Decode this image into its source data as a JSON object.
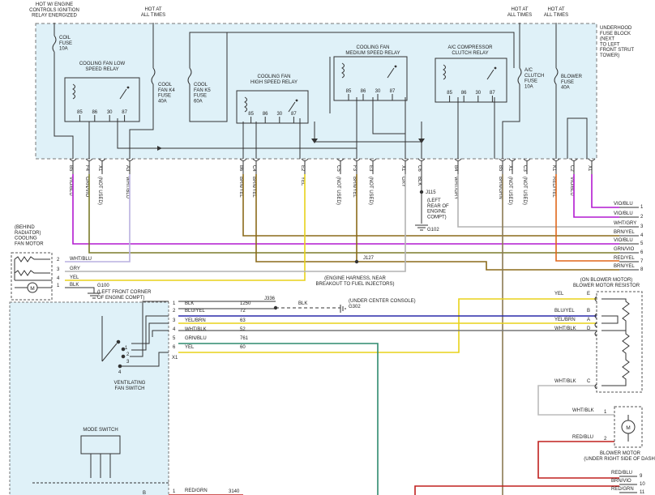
{
  "colors": {
    "fuse_block_fill": "#dff1f8",
    "wire_vio_blu": "#b21ad0",
    "wire_grn_vio": "#7b7b2a",
    "wire_wht_blu": "#b9b0e0",
    "wire_gry": "#b3b3b3",
    "wire_yel": "#e8d21a",
    "wire_brn_yel": "#8b6a1a",
    "wire_red_yel": "#e0671a",
    "wire_blu_yel": "#2a2aa8",
    "wire_grn_blu": "#2f8a6e",
    "wire_red_grn": "#c0201e",
    "wire_red_blu": "#c0201e"
  },
  "top_notes": {
    "hot_ign": "HOT W/ ENGINE\nCONTROLS IGNITION\nRELAY ENERGIZED",
    "hot_all_1": "HOT AT\nALL TIMES",
    "hot_all_2": "HOT AT\nALL TIMES",
    "hot_all_3": "HOT AT\nALL TIMES",
    "fuse_block": "UNDERHOOD\nFUSE BLOCK\n(NEXT\nTO LEFT\nFRONT STRUT\nTOWER)"
  },
  "fuses": {
    "coil": "COIL\nFUSE\n10A",
    "k4": "COOL\nFAN K4\nFUSE\n40A",
    "k5": "COOL\nFAN K5\nFUSE\n60A",
    "ac_clutch": "A/C\nCLUTCH\nFUSE\n10A",
    "blower": "BLOWER\nFUSE\n40A"
  },
  "relays": {
    "low": "COOLING FAN LOW\nSPEED RELAY",
    "high": "COOLING FAN\nHIGH SPEED RELAY",
    "medium": "COOLING FAN\nMEDIUM SPEED RELAY",
    "ac": "A/C COMPRESSOR\nCLUTCH RELAY",
    "pins": [
      "85",
      "86",
      "30",
      "87"
    ]
  },
  "connector_pins": [
    {
      "pin": "B5",
      "wire": "VIO/BLU"
    },
    {
      "pin": "F4",
      "wire": "GRN/VIO"
    },
    {
      "pin": "X1",
      "wire": "(NOT USED)"
    },
    {
      "pin": "A3",
      "wire": "WHT/BLU"
    },
    {
      "pin": "B6",
      "wire": "BRN/YEL"
    },
    {
      "pin": "C4",
      "wire": "BRN/YEL"
    },
    {
      "pin": "E2",
      "wire": "YEL"
    },
    {
      "pin": "C5",
      "wire": "(NOT USED)"
    },
    {
      "pin": "F3",
      "wire": "BRN/YEL"
    },
    {
      "pin": "E3",
      "wire": "(NOT USED)"
    },
    {
      "pin": "X1",
      "wire": "GRY"
    },
    {
      "pin": "C6",
      "wire": "BLK"
    },
    {
      "pin": "B4",
      "wire": "WHT/GRY"
    },
    {
      "pin": "B5",
      "wire": "BRN/GRN"
    },
    {
      "pin": "X1",
      "wire": "(NOT USED)"
    },
    {
      "pin": "C3",
      "wire": "(NOT USED)"
    },
    {
      "pin": "K1",
      "wire": "RED/YEL"
    },
    {
      "pin": "C2",
      "wire": "VIO/BLU"
    },
    {
      "pin": "X1",
      "wire": ""
    }
  ],
  "ground_labels": {
    "j115": "J115",
    "left_rear": "(LEFT\nREAR OF\nENGINE\nCOMPT)",
    "g102": "G102",
    "j127": "J127",
    "harness": "(ENGINE HARNESS, NEAR\nBREAKOUT TO FUEL INJECTORS)",
    "g100": "G100",
    "g100_loc": "(LEFT FRONT CORNER\nOF ENGINE COMPT)",
    "j336": "J336",
    "blk": "BLK",
    "g302": "(UNDER CENTER CONSOLE)\nG302"
  },
  "right_wires": [
    {
      "label": "VIO/BLU",
      "num": "1"
    },
    {
      "label": "VIO/BLU",
      "num": "2"
    },
    {
      "label": "WHT/GRY",
      "num": "3"
    },
    {
      "label": "BRN/YEL",
      "num": "4"
    },
    {
      "label": "VIO/BLU",
      "num": "5"
    },
    {
      "label": "GRN/VIO",
      "num": "6"
    },
    {
      "label": "RED/YEL",
      "num": "7"
    },
    {
      "label": "BRN/YEL",
      "num": "8"
    }
  ],
  "fan_motor": {
    "title": "(BEHIND\nRADIATOR)\nCOOLING\nFAN MOTOR",
    "pins": [
      {
        "n": "2",
        "wire": "WHT/BLU"
      },
      {
        "n": "3",
        "wire": "GRY"
      },
      {
        "n": "4",
        "wire": "YEL"
      },
      {
        "n": "1",
        "wire": "BLK"
      }
    ]
  },
  "fan_switch_wires": [
    {
      "n": "1",
      "wire": "BLK",
      "circuit": "1250"
    },
    {
      "n": "2",
      "wire": "BLU/YEL",
      "circuit": "72"
    },
    {
      "n": "3",
      "wire": "YEL/BRN",
      "circuit": "63"
    },
    {
      "n": "4",
      "wire": "WHT/BLK",
      "circuit": "52"
    },
    {
      "n": "5",
      "wire": "GRN/BLU",
      "circuit": "761"
    },
    {
      "n": "6",
      "wire": "YEL",
      "circuit": "60"
    }
  ],
  "fan_switch": {
    "label": "VENTILATING\nFAN SWITCH",
    "x1": "X1",
    "taps": [
      "1",
      "2",
      "3",
      "4"
    ]
  },
  "mode_switch": "MODE SWITCH",
  "bottom_wires": [
    {
      "n": "1",
      "wire": "RED/GRN",
      "circuit": "3140"
    }
  ],
  "resistor": {
    "title": "(ON BLOWER MOTOR)\nBLOWER MOTOR RESISTOR",
    "pins": [
      {
        "wire": "YEL",
        "pin": "E"
      },
      {
        "wire": "BLU/YEL",
        "pin": "B"
      },
      {
        "wire": "YEL/BRN",
        "pin": "A"
      },
      {
        "wire": "WHT/BLK",
        "pin": "D"
      },
      {
        "wire": "WHT/BLK",
        "pin": "C"
      }
    ]
  },
  "blower_motor": {
    "label": "BLOWER MOTOR\n(UNDER RIGHT SIDE OF DASH)",
    "wht_blk": "WHT/BLK",
    "red_blu": "RED/BLU",
    "pin1": "1",
    "pin2": "2"
  },
  "bottom_right": [
    {
      "label": "RED/BLU",
      "num": "9"
    },
    {
      "label": "BRN/VIO",
      "num": "10"
    },
    {
      "label": "RED/GRN",
      "num": "11"
    }
  ]
}
